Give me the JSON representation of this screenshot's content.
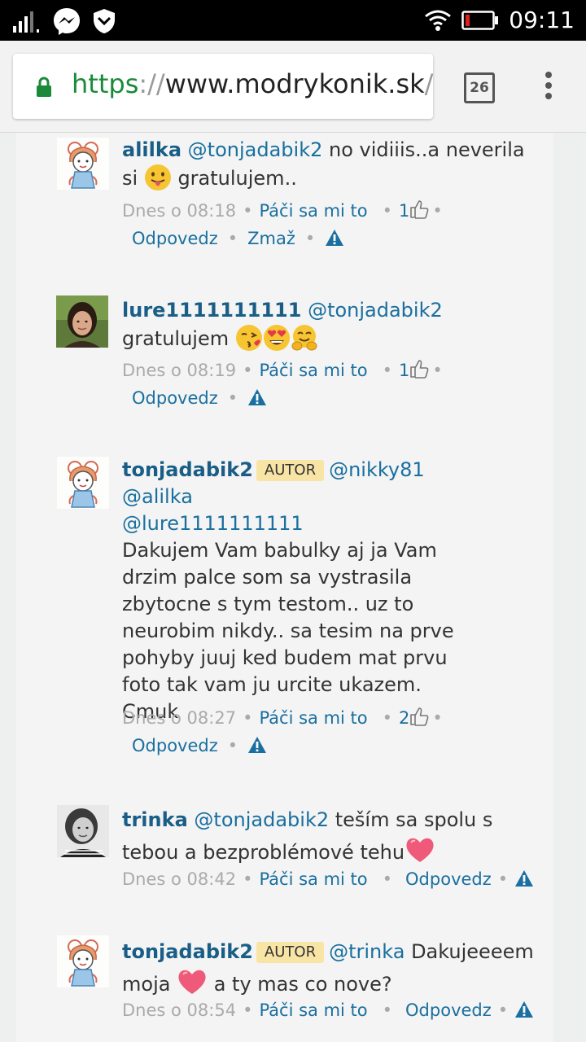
{
  "status_bar": {
    "time": "09:11"
  },
  "browser": {
    "url_scheme": "https",
    "url_sep": "://",
    "url_host": "www.modrykonik.sk",
    "url_rest": "/gr",
    "tab_count": "26"
  },
  "colors": {
    "link": "#1a6fa0",
    "username": "#1a5e88",
    "autor_badge": "#f8e5a6",
    "secure": "#1a8a3a"
  },
  "comments": [
    {
      "user": "alilka",
      "mention": "@tonjadabik2",
      "text1": " no vidiiis..a neverila",
      "text2": "si ",
      "text3": " gratulujem..",
      "time": "Dnes o 08:18",
      "like": "Páči sa mi to",
      "count": "1",
      "reply": "Odpovedz",
      "delete": "Zmaž"
    },
    {
      "user": "lure1111111111",
      "mention": "@tonjadabik2",
      "text1": "gratulujem ",
      "time": "Dnes o 08:19",
      "like": "Páči sa mi to",
      "count": "1",
      "reply": "Odpovedz"
    },
    {
      "user": "tonjadabik2",
      "badge": "AUTOR",
      "mention1": "@nikky81",
      "mention2": "@alilka",
      "mention3": "@lure1111111111",
      "text": "Dakujem Vam babulky aj ja Vam drzim palce som sa vystrasila zbytocne s tym testom.. uz to neurobim nikdy.. sa tesim na prve pohyby juuj ked budem mat prvu foto tak vam ju urcite ukazem. Cmuk",
      "time": "Dnes o 08:27",
      "like": "Páči sa mi to",
      "count": "2",
      "reply": "Odpovedz"
    },
    {
      "user": "trinka",
      "mention": "@tonjadabik2",
      "text1": " teším sa spolu s tebou a bezproblémové tehu",
      "time": "Dnes o 08:42",
      "like": "Páči sa mi to",
      "reply": "Odpovedz"
    },
    {
      "user": "tonjadabik2",
      "badge": "AUTOR",
      "mention": "@trinka",
      "text1": " Dakujeeeem moja ",
      "text2": " a ty mas co nove?",
      "time": "Dnes o 08:54",
      "like": "Páči sa mi to",
      "reply": "Odpovedz"
    }
  ]
}
